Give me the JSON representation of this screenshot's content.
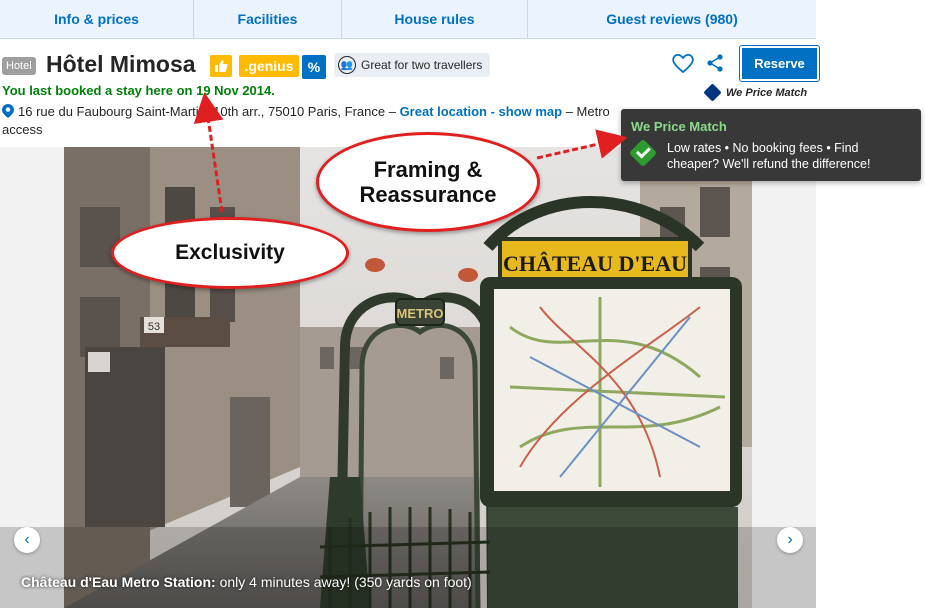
{
  "tabs": [
    "Info & prices",
    "Facilities",
    "House rules",
    "Guest reviews (980)"
  ],
  "header": {
    "type_badge": "Hotel",
    "hotel_name": "Hôtel Mimosa",
    "genius_label": ".genius",
    "discount_symbol": "%",
    "travel_pill": "Great for two travellers",
    "reserve_label": "Reserve",
    "price_match_label": "We Price Match",
    "last_booked": "You last booked a stay here on 19 Nov 2014.",
    "address": "16 rue du Faubourg Saint-Martin, 10th arr., 75010 Paris, France –",
    "location_link": "Great location - show map",
    "address_suffix": "– Metro access"
  },
  "photo": {
    "caption_bold": "Château d'Eau Metro Station:",
    "caption_text": "only 4 minutes away! (350 yards on foot)",
    "sign_text": "CHÂTEAU D'EAU",
    "metro_text": "METRO",
    "building_number": "53",
    "prev_icon": "‹",
    "next_icon": "›"
  },
  "tooltip": {
    "title": "We Price Match",
    "body": "Low rates • No booking fees • Find cheaper? We'll refund the difference!"
  },
  "annotations": {
    "exclusivity": "Exclusivity",
    "framing": "Framing & Reassurance"
  },
  "colors": {
    "brand_blue": "#0071c2",
    "genius_yellow": "#febb02",
    "green": "#008009",
    "annotation_red": "#e02020"
  }
}
